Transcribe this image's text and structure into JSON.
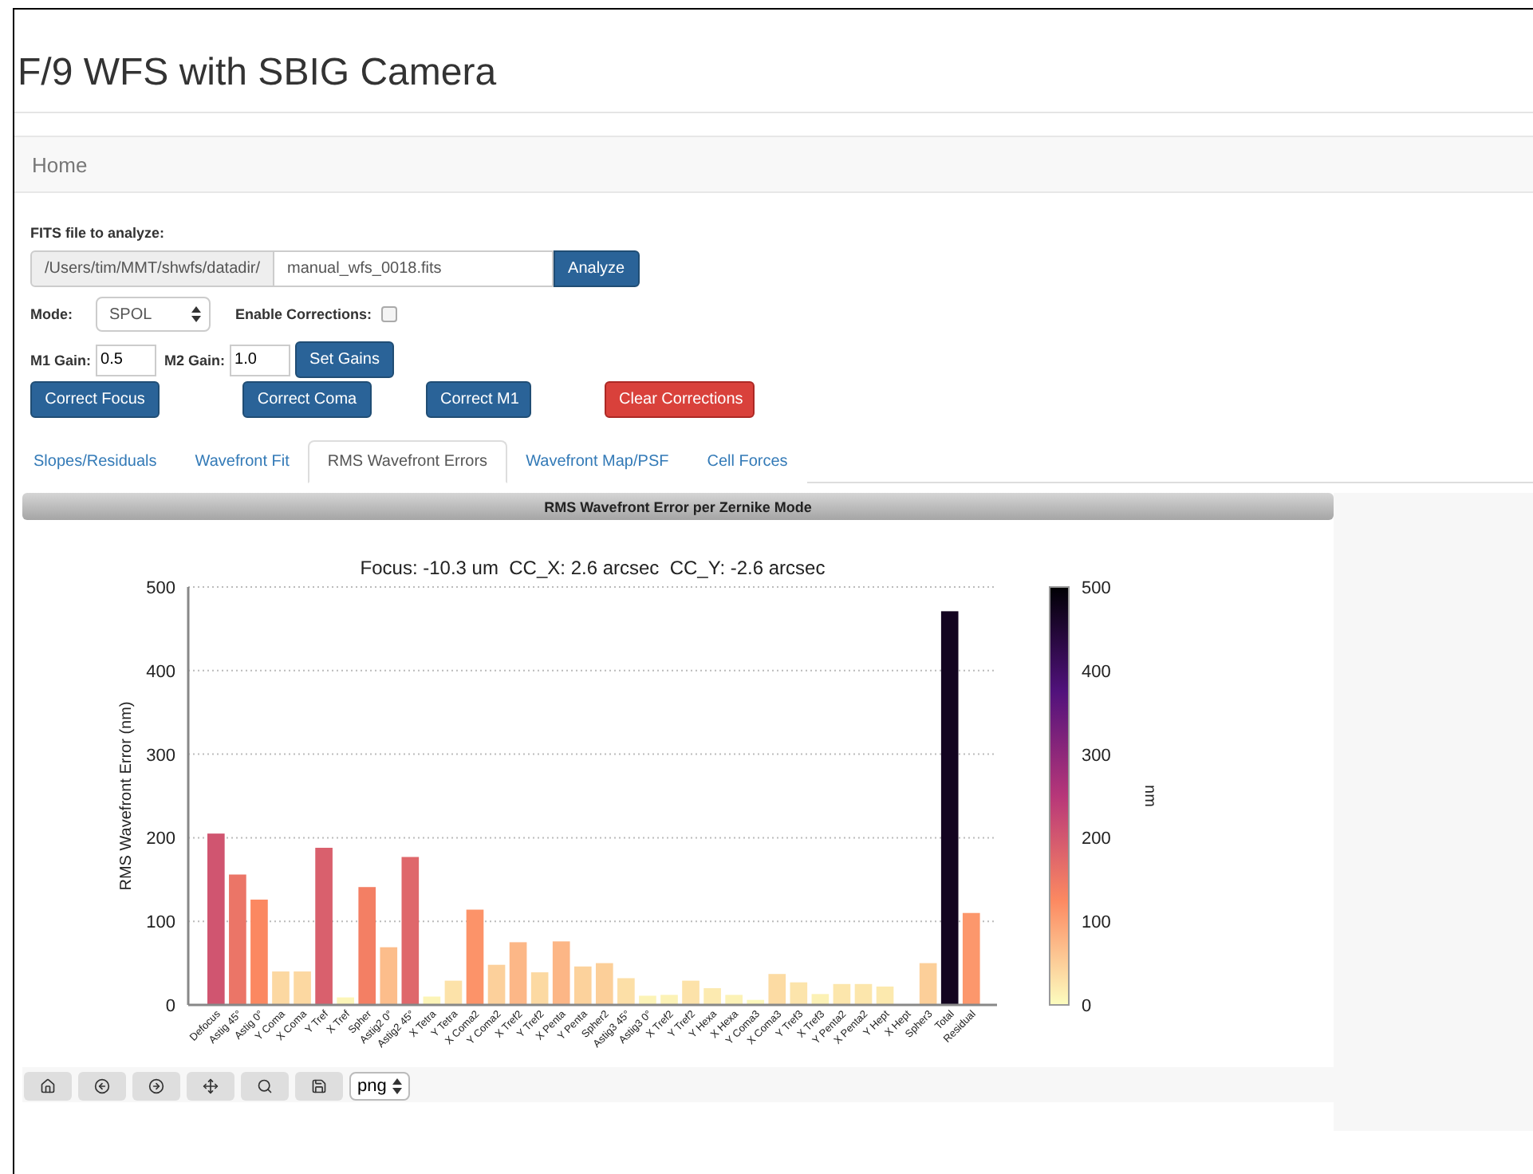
{
  "page_title": "F/9 WFS with SBIG Camera",
  "navbar": {
    "brand": "Home"
  },
  "form": {
    "file_label": "FITS file to analyze:",
    "path_prefix": "/Users/tim/MMT/shwfs/datadir/",
    "file_value": "manual_wfs_0018.fits",
    "analyze_button": "Analyze",
    "mode_label": "Mode:",
    "mode_value": "SPOL",
    "corrections_label": "Enable Corrections:",
    "corrections_checked": false,
    "m1_label": "M1 Gain:",
    "m1_value": "0.5",
    "m2_label": "M2 Gain:",
    "m2_value": "1.0",
    "set_gains_button": "Set Gains",
    "actions": [
      {
        "label": "Correct Focus",
        "kind": "primary"
      },
      {
        "label": "Correct Coma",
        "kind": "primary"
      },
      {
        "label": "Correct M1",
        "kind": "primary"
      },
      {
        "label": "Clear Corrections",
        "kind": "danger"
      }
    ]
  },
  "tabs": [
    {
      "label": "Slopes/Residuals",
      "selected": false
    },
    {
      "label": "Wavefront Fit",
      "selected": false
    },
    {
      "label": "RMS Wavefront Errors",
      "selected": true
    },
    {
      "label": "Wavefront Map/PSF",
      "selected": false
    },
    {
      "label": "Cell Forces",
      "selected": false
    }
  ],
  "panel": {
    "heading": "RMS Wavefront Error per Zernike Mode",
    "chart_data": {
      "type": "bar",
      "title": "Focus: -10.3 um  CC_X: 2.6 arcsec  CC_Y: -2.6 arcsec",
      "ylabel": "RMS Wavefront Error (nm)",
      "categories": [
        "Defocus",
        "Astig 45°",
        "Astig 0°",
        "Y Coma",
        "X Coma",
        "Y Tref",
        "X Tref",
        "Spher",
        "Astig2 0°",
        "Astig2 45°",
        "X Tetra",
        "Y Tetra",
        "X Coma2",
        "Y Coma2",
        "X Tref2",
        "Y Tref2",
        "X Penta",
        "Y Penta",
        "Spher2",
        "Astig3 45°",
        "Astig3 0°",
        "X Tref2",
        "Y Tref2",
        "Y Hexa",
        "X Hexa",
        "Y Coma3",
        "X Coma3",
        "Y Tref3",
        "X Tref3",
        "Y Penta2",
        "X Penta2",
        "Y Hept",
        "X Hept",
        "Spher3",
        "Total",
        "Residual"
      ],
      "values": [
        205,
        156,
        126,
        40,
        40,
        188,
        9,
        141,
        69,
        177,
        10,
        29,
        114,
        48,
        75,
        39,
        76,
        46,
        50,
        32,
        11,
        12,
        29,
        20,
        12,
        6,
        37,
        27,
        13,
        25,
        25,
        22,
        0,
        50,
        471,
        110
      ],
      "ylim": [
        0,
        500
      ],
      "yticks": [
        0,
        100,
        200,
        300,
        400,
        500
      ],
      "grid": true
    },
    "colorbar": {
      "label": "nm",
      "ticks": [
        "500",
        "400",
        "300",
        "200",
        "100",
        "0"
      ]
    },
    "toolbar": {
      "format": "png"
    }
  }
}
